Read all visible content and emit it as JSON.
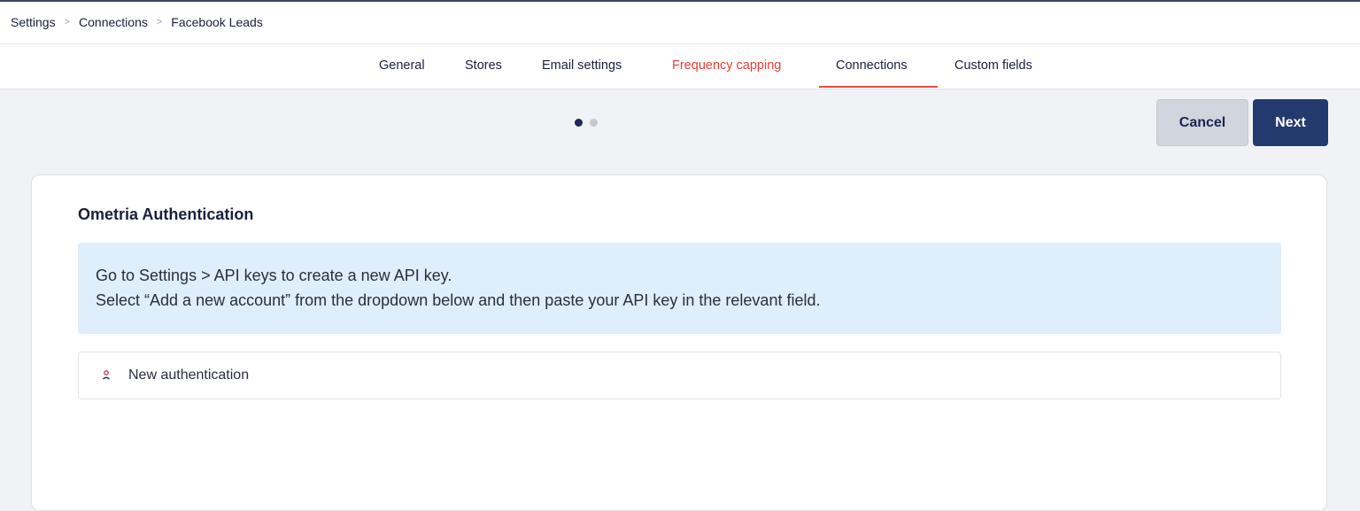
{
  "breadcrumb": {
    "items": [
      "Settings",
      "Connections",
      "Facebook Leads"
    ],
    "separator": ">"
  },
  "tabs": [
    {
      "label": "General",
      "highlighted": false
    },
    {
      "label": "Stores",
      "highlighted": false
    },
    {
      "label": "Email settings",
      "highlighted": false
    },
    {
      "label": "Frequency capping",
      "highlighted": true
    },
    {
      "label": "Connections",
      "highlighted": false,
      "active": true
    },
    {
      "label": "Custom fields",
      "highlighted": false
    }
  ],
  "stepper": {
    "current_step": 1,
    "total_steps": 2
  },
  "actions": {
    "cancel_label": "Cancel",
    "next_label": "Next"
  },
  "card": {
    "title": "Ometria Authentication",
    "info_lines": [
      "Go to Settings > API keys to create a new API key.",
      "Select “Add a new account” from the dropdown below and then paste your API key in the relevant field."
    ],
    "auth_option": {
      "icon": "user-icon",
      "label": "New authentication"
    }
  },
  "colors": {
    "accent_red": "#ef3b33",
    "primary_navy": "#233a6e",
    "info_bg": "#deeefb"
  }
}
